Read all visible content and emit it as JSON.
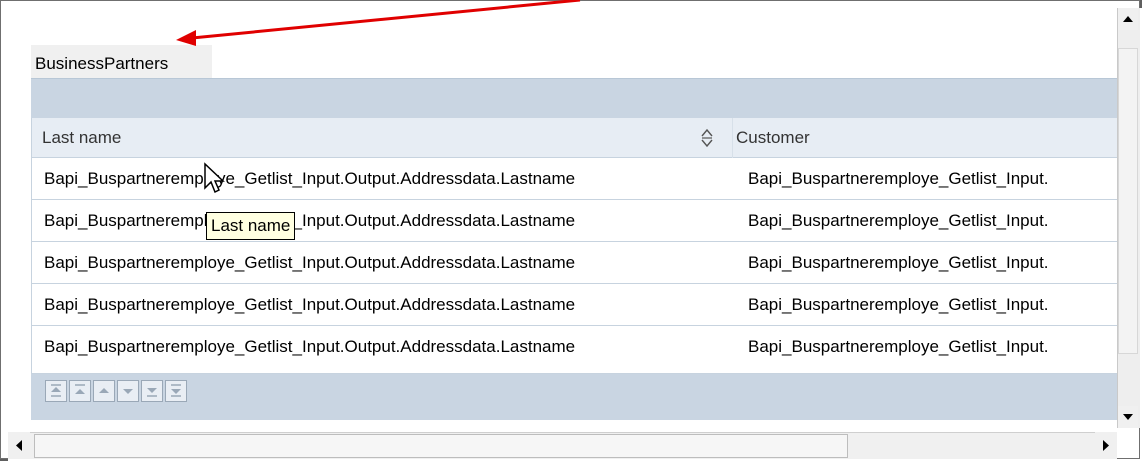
{
  "tab": {
    "label": "BusinessPartners"
  },
  "table": {
    "columns": [
      {
        "label": "Last name"
      },
      {
        "label": "Customer"
      }
    ],
    "rows": [
      [
        "Bapi_Buspartneremploye_Getlist_Input.Output.Addressdata.Lastname",
        "Bapi_Buspartneremploye_Getlist_Input."
      ],
      [
        "Bapi_Buspartneremploye_Getlist_Input.Output.Addressdata.Lastname",
        "Bapi_Buspartneremploye_Getlist_Input."
      ],
      [
        "Bapi_Buspartneremploye_Getlist_Input.Output.Addressdata.Lastname",
        "Bapi_Buspartneremploye_Getlist_Input."
      ],
      [
        "Bapi_Buspartneremploye_Getlist_Input.Output.Addressdata.Lastname",
        "Bapi_Buspartneremploye_Getlist_Input."
      ],
      [
        "Bapi_Buspartneremploye_Getlist_Input.Output.Addressdata.Lastname",
        "Bapi_Buspartneremploye_Getlist_Input."
      ]
    ]
  },
  "tooltip": {
    "text": "Last name"
  },
  "pager": {
    "buttons": [
      "first-page-icon",
      "previous-page-icon",
      "previous-row-icon",
      "next-row-icon",
      "next-page-icon",
      "last-page-icon"
    ]
  },
  "colors": {
    "band": "#c9d5e2",
    "header": "#e7edf4",
    "annotation_arrow": "#e00000",
    "tooltip_bg": "#ffffe1"
  }
}
